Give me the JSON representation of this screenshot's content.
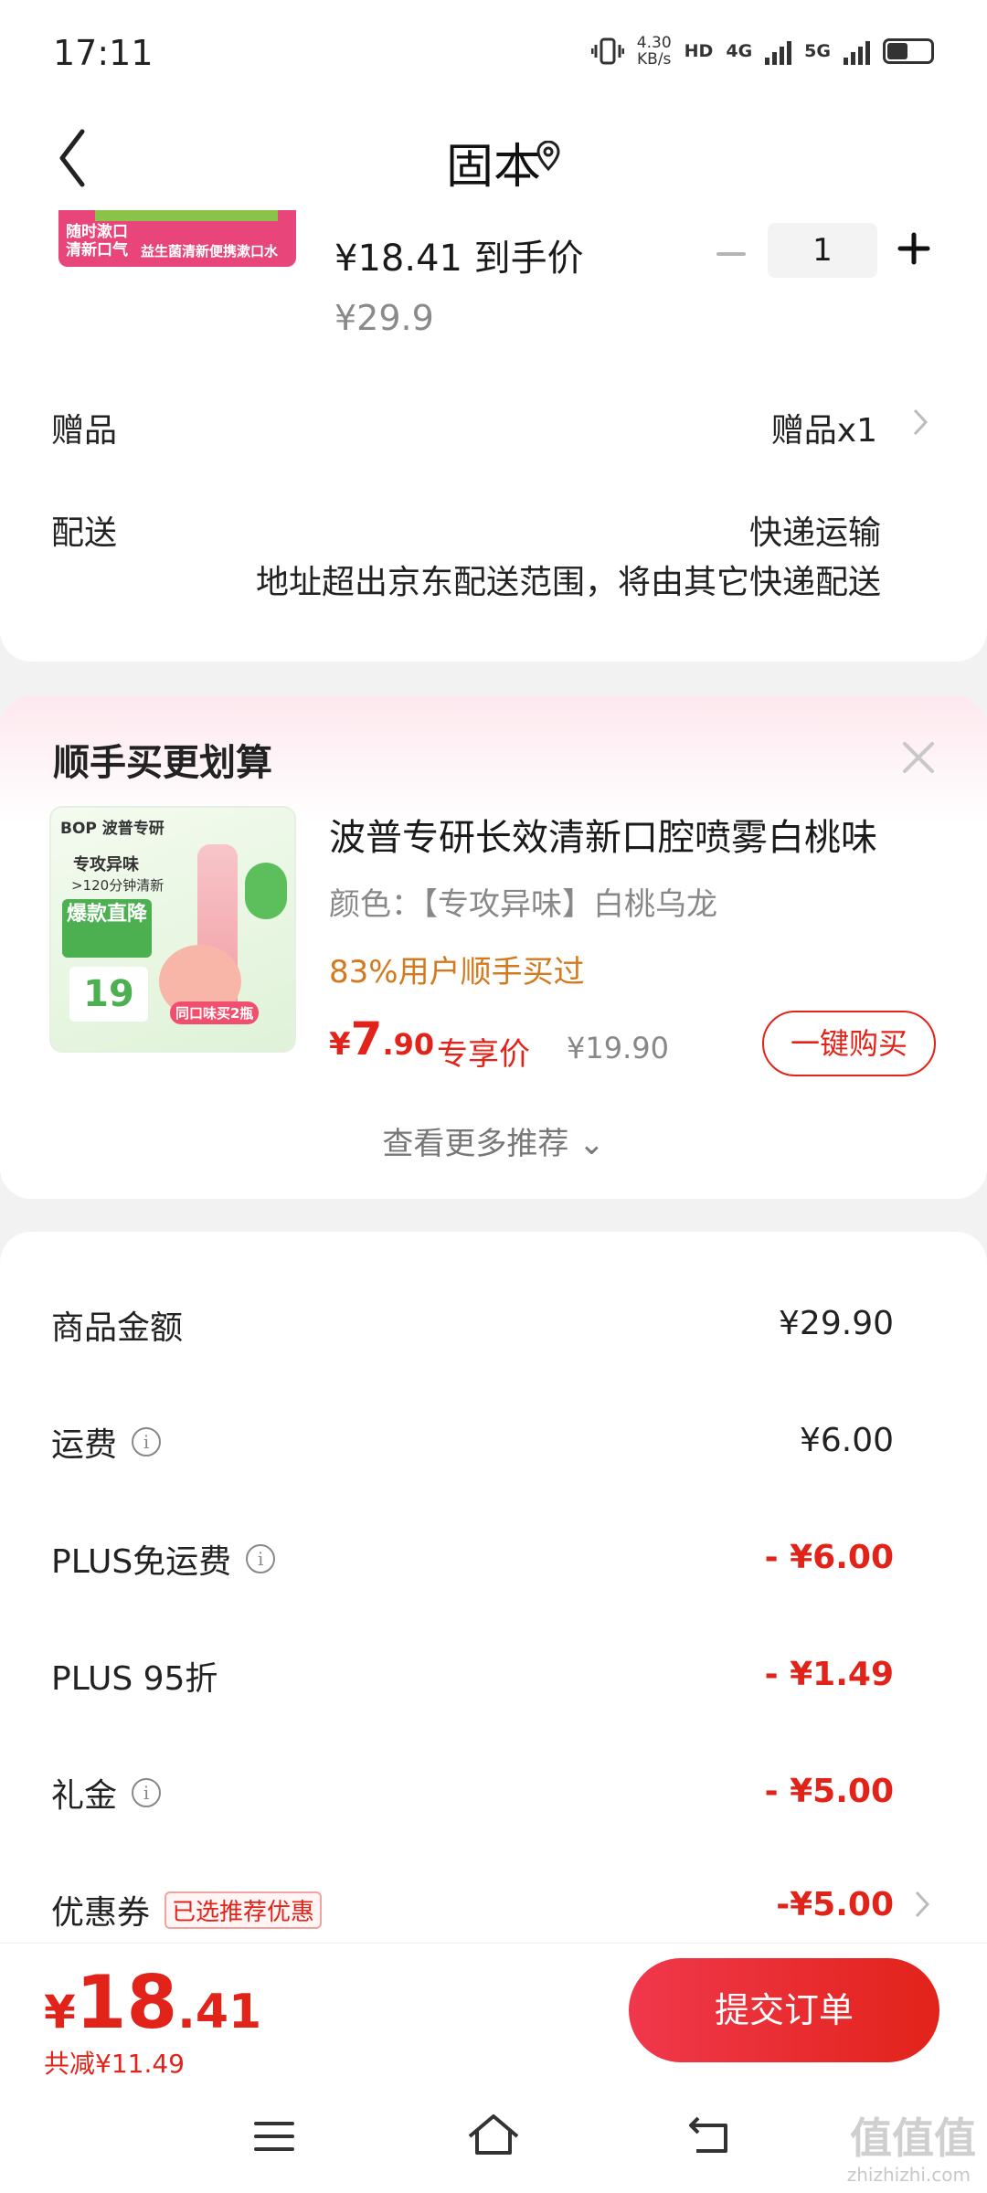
{
  "status": {
    "time": "17:11",
    "speed_top": "4.30",
    "speed_bottom": "KB/s",
    "hd": "HD",
    "net1": "4G",
    "net2": "5G"
  },
  "header": {
    "title": "固本"
  },
  "product": {
    "thumb_line1": "随时漱口",
    "thumb_line2": "清新口气",
    "thumb_caption": "益生菌清新便携漱口水",
    "price_final": "¥18.41 到手价",
    "price_original": "¥29.9",
    "quantity": "1"
  },
  "gift": {
    "label": "赠品",
    "value": "赠品x1"
  },
  "shipping": {
    "label": "配送",
    "value": "快递运输",
    "note": "地址超出京东配送范围，将由其它快递配送"
  },
  "recommend": {
    "section_title": "顺手买更划算",
    "img_brand": "BOP 波普专研",
    "img_line1": "专攻异味",
    "img_line2": ">120分钟清新",
    "img_hot": "爆款直降",
    "img_price": "19",
    "img_tag": "同口味买2瓶",
    "name": "波普专研长效清新口腔喷雾白桃味",
    "color": "颜色：【专攻异味】白桃乌龙",
    "bought": "83%用户顺手买过",
    "price_currency": "¥",
    "price_int": "7",
    "price_dec": ".90",
    "exclusive_label": "专享价",
    "original_price": "¥19.90",
    "buy_button": "一键购买",
    "more_link": "查看更多推荐 ⌄"
  },
  "summary": {
    "rows": [
      {
        "label": "商品金额",
        "value": "¥29.90"
      },
      {
        "label": "运费",
        "value": "¥6.00"
      },
      {
        "label": "PLUS免运费",
        "value": "- ¥6.00"
      },
      {
        "label": "PLUS 95折",
        "value": "- ¥1.49"
      },
      {
        "label": "礼金",
        "value": "- ¥5.00"
      },
      {
        "label": "优惠券",
        "value": "-¥5.00"
      }
    ],
    "coupon_tag": "已选推荐优惠"
  },
  "footer": {
    "total_currency": "¥",
    "total_int": "18",
    "total_dec": ".41",
    "saved": "共减¥11.49",
    "submit": "提交订单"
  },
  "watermark": {
    "main": "值值值",
    "sub": "zhizhizhi.com"
  },
  "colors": {
    "accent_red": "#e2231a",
    "orange": "#d4791c"
  }
}
